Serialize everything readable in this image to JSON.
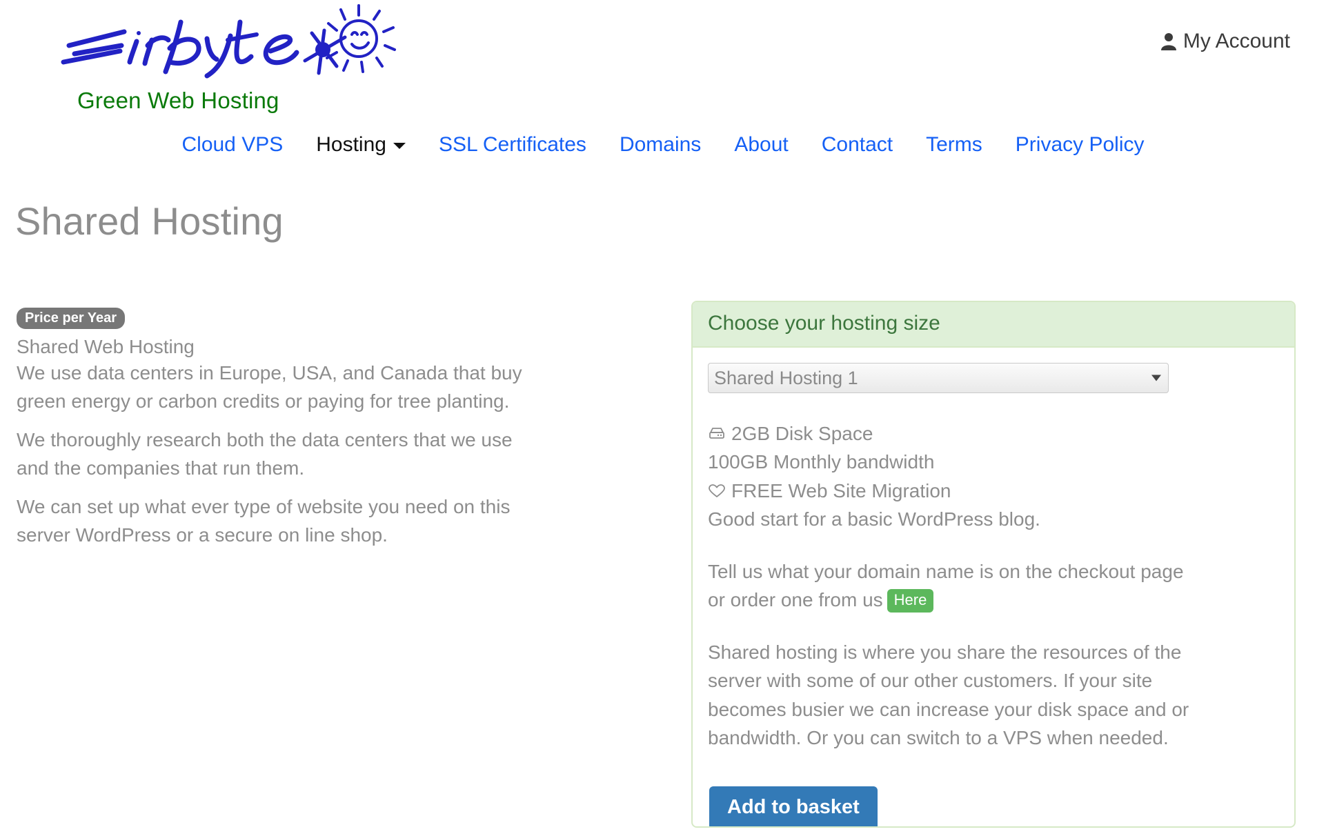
{
  "brand": {
    "logo_text": "Eirbyte",
    "logo_icon": "sun-doodle-icon",
    "tagline": "Green Web Hosting",
    "tagline_color": "#0a7a0a",
    "logo_color": "#2020c0"
  },
  "header": {
    "account_label": "My Account",
    "account_icon": "person-icon"
  },
  "nav": {
    "items": [
      {
        "label": "Cloud VPS",
        "active": false
      },
      {
        "label": "Hosting",
        "active": true,
        "has_dropdown": true
      },
      {
        "label": "SSL Certificates",
        "active": false
      },
      {
        "label": "Domains",
        "active": false
      },
      {
        "label": "About",
        "active": false
      },
      {
        "label": "Contact",
        "active": false
      },
      {
        "label": "Terms",
        "active": false
      },
      {
        "label": "Privacy Policy",
        "active": false
      }
    ],
    "link_color": "#1560f5",
    "active_color": "#111111"
  },
  "page": {
    "title": "Shared Hosting"
  },
  "left": {
    "price_badge": "Price per Year",
    "sub_title": "Shared Web Hosting",
    "paragraphs": [
      "We use data centers in Europe, USA, and Canada that buy green energy or carbon credits or paying for tree planting.",
      "We thoroughly research both the data centers that we use and the companies that run them.",
      "We can set up what ever type of website you need on this server WordPress or a secure on line shop."
    ]
  },
  "panel": {
    "heading": "Choose your hosting size",
    "heading_bg": "#dff0d8",
    "heading_color": "#3c763d",
    "border_color": "#d6e9c6",
    "select": {
      "selected": "Shared Hosting 1",
      "arrow_icon": "chevron-down-icon"
    },
    "features": [
      {
        "icon": "hard-drive-icon",
        "text": "2GB Disk Space"
      },
      {
        "icon": "",
        "text": "100GB Monthly bandwidth"
      },
      {
        "icon": "heart-icon",
        "text": "FREE Web Site Migration"
      },
      {
        "icon": "",
        "text": "Good start for a basic WordPress blog."
      }
    ],
    "domain_note_before": "Tell us what your domain name is on the checkout page or order one from us",
    "domain_note_badge": "Here",
    "domain_note_badge_color": "#5cb85c",
    "description": "Shared hosting is where you share the resources of the server with some of our other customers. If your site becomes busier we can increase your disk space and or bandwidth. Or you can switch to a VPS when needed.",
    "add_button": "Add to basket",
    "add_button_color": "#337ab7"
  }
}
